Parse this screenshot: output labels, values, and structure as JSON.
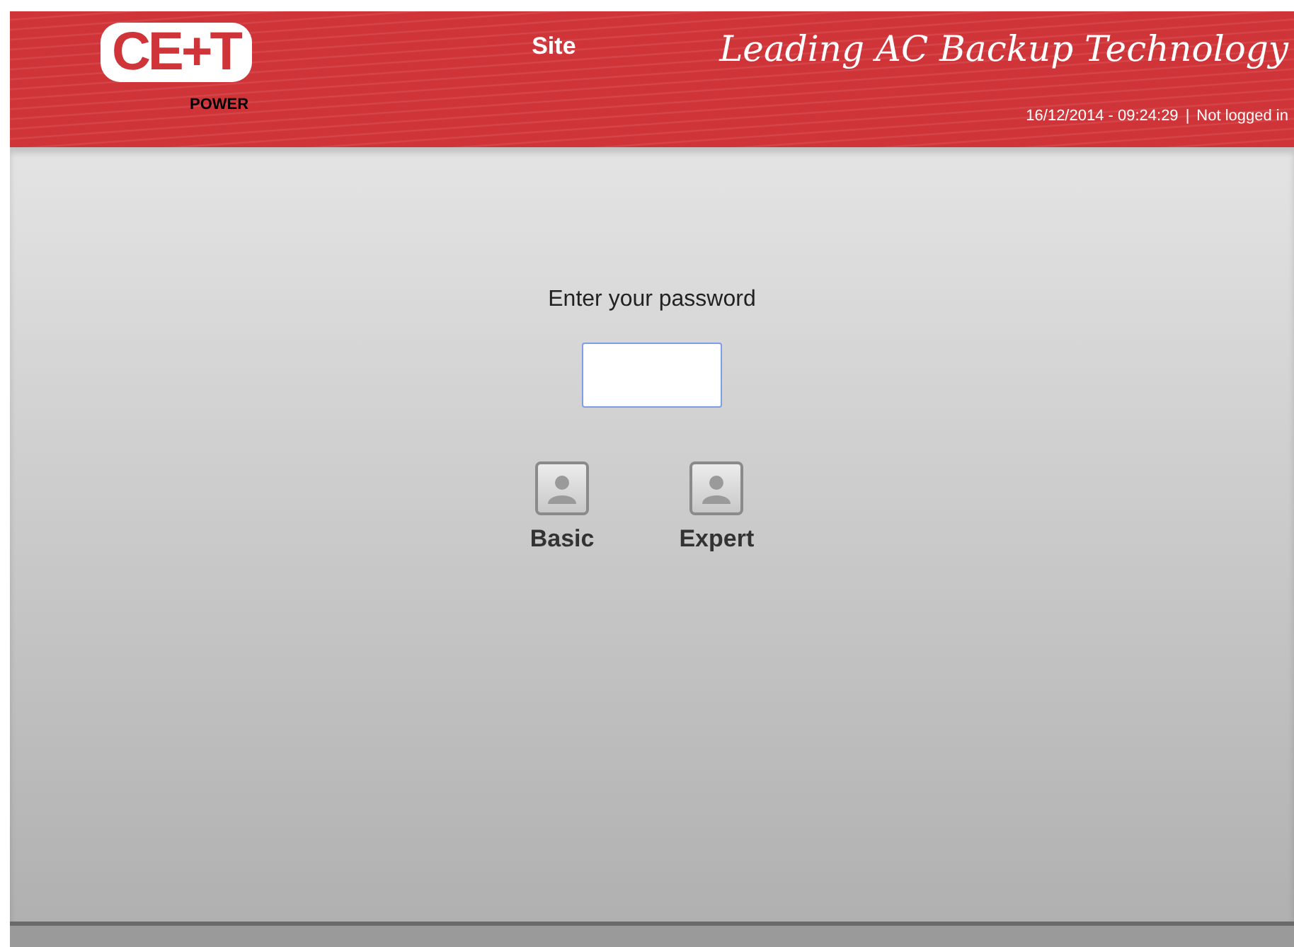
{
  "header": {
    "logo": {
      "main": "CE+T",
      "sub": "POWER"
    },
    "title": "Site",
    "tagline": "Leading AC Backup Technology",
    "datetime": "16/12/2014 - 09:24:29",
    "separator": "|",
    "login_status": "Not logged in"
  },
  "login": {
    "prompt": "Enter your password",
    "profiles": [
      {
        "label": "Basic"
      },
      {
        "label": "Expert"
      }
    ]
  }
}
